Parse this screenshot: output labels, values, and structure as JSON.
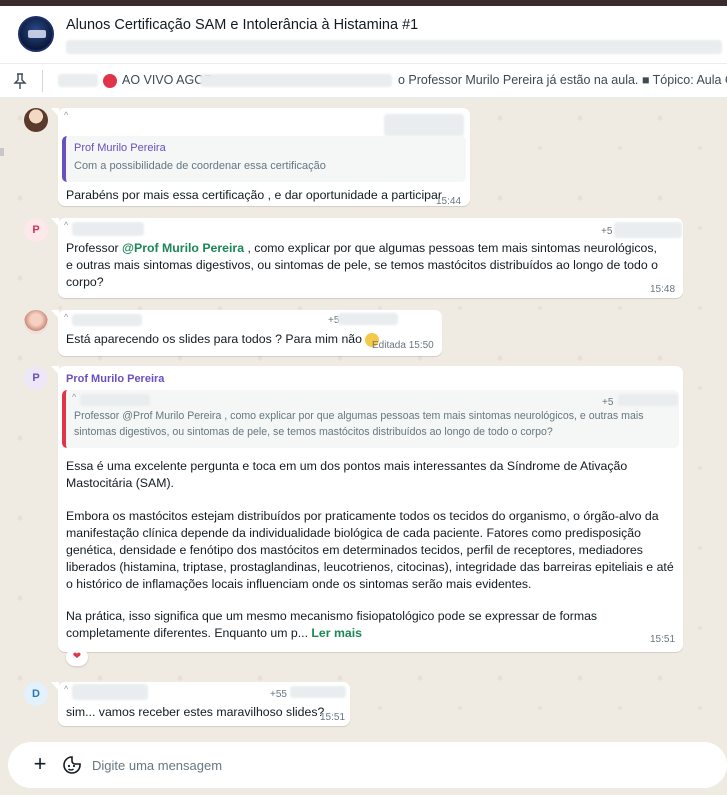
{
  "header": {
    "title": "Alunos Certificação SAM e Intolerância à Histamina #1",
    "avatar_icon": "group-avatar"
  },
  "pinned": {
    "icon": "pin-icon",
    "live_label": "AO VIVO AGOR",
    "text": "o Professor Murilo Pereira já estão na aula. ■ Tópico: Aula Cer"
  },
  "messages": [
    {
      "id": "m1",
      "quote_name": "Prof Murilo Pereira",
      "quote_text": "Com a possibilidade de coordenar essa certificação",
      "text": "Parabéns por mais essa certificação , e dar oportunidade a participar",
      "time": "15:44"
    },
    {
      "id": "m2",
      "avatar_letter": "P",
      "phone_fragment": "+5",
      "text_before": "Professor ",
      "mention": "@Prof Murilo Pereira",
      "text_after": " , como explicar por que algumas pessoas tem mais sintomas neurológicos,  e outras mais sintomas digestivos, ou sintomas de pele, se temos mastócitos distribuídos ao longo de todo o corpo?",
      "time": "15:48"
    },
    {
      "id": "m3",
      "phone_fragment": "+5",
      "text": "Está aparecendo os slides para todos ? Para mim não",
      "edited_time": "Editada 15:50"
    },
    {
      "id": "m4",
      "avatar_letter": "P",
      "sender": "Prof Murilo Pereira",
      "quote_phone": "+5",
      "quote_text": "Professor @Prof Murilo Pereira , como explicar por que algumas pessoas tem mais sintomas neurológicos,  e outras mais sintomas digestivos, ou sintomas de pele, se temos mastócitos distribuídos ao longo de todo o corpo?",
      "paragraph1": "Essa é uma excelente pergunta e toca em um dos pontos mais interessantes da Síndrome de Ativação Mastocitária (SAM).",
      "paragraph2": "Embora os mastócitos estejam distribuídos por praticamente todos os tecidos do organismo, o órgão-alvo da manifestação clínica depende da individualidade biológica de cada paciente. Fatores como predisposição genética, densidade e fenótipo dos mastócitos em determinados tecidos, perfil de receptores, mediadores liberados (histamina, triptase, prostaglandinas, leucotrienos, citocinas), integridade das barreiras epiteliais e até o histórico de inflamações locais influenciam onde os sintomas serão mais evidentes.",
      "paragraph3": "Na prática, isso significa que um mesmo mecanismo fisiopatológico pode se expressar de formas completamente diferentes. Enquanto um p...",
      "read_more": "Ler mais",
      "time": "15:51",
      "reaction": "❤"
    },
    {
      "id": "m5",
      "avatar_letter": "D",
      "phone_fragment": "+55",
      "text": "sim... vamos receber estes maravilhoso slides?",
      "time": "15:51"
    }
  ],
  "composer": {
    "placeholder": "Digite uma mensagem",
    "plus_icon": "plus-icon",
    "sticker_icon": "sticker-icon"
  },
  "colors": {
    "chat_bg": "#efeae2",
    "accent_green": "#1b8755",
    "purple_name": "#6a4fbf",
    "live_red": "#e0344b"
  }
}
